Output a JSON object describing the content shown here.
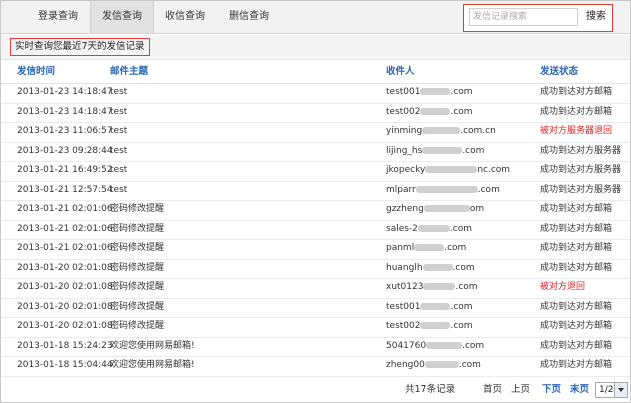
{
  "tabs": [
    {
      "label": "登录查询",
      "active": false
    },
    {
      "label": "发信查询",
      "active": true
    },
    {
      "label": "收信查询",
      "active": false
    },
    {
      "label": "删信查询",
      "active": false
    }
  ],
  "search": {
    "placeholder": "发信记录搜索",
    "button": "搜索"
  },
  "notice": "实时查询您最近7天的发信记录",
  "columns": {
    "time": "发信时间",
    "subject": "邮件主题",
    "recipient": "收件人",
    "status": "发送状态"
  },
  "rows": [
    {
      "time": "2013-01-23 14:18:47",
      "subject": "test",
      "rcpt_prefix": "test001",
      "rcpt_suffix": ".com",
      "status": "成功到达对方邮箱",
      "status_type": "ok"
    },
    {
      "time": "2013-01-23 14:18:47",
      "subject": "test",
      "rcpt_prefix": "test002",
      "rcpt_suffix": ".com",
      "status": "成功到达对方邮箱",
      "status_type": "ok"
    },
    {
      "time": "2013-01-23 11:06:57",
      "subject": "test",
      "rcpt_prefix": "yinming",
      "rcpt_suffix": ".com.cn",
      "status": "被对方服务器退回",
      "status_type": "error"
    },
    {
      "time": "2013-01-23 09:28:44",
      "subject": "test",
      "rcpt_prefix": "lijing_hs",
      "rcpt_suffix": ".com",
      "status": "成功到达对方服务器",
      "status_type": "ok"
    },
    {
      "time": "2013-01-21 16:49:52",
      "subject": "test",
      "rcpt_prefix": "jkopecky",
      "rcpt_suffix": "nc.com",
      "status": "成功到达对方服务器",
      "status_type": "ok"
    },
    {
      "time": "2013-01-21 12:57:54",
      "subject": "test",
      "rcpt_prefix": "mlparr",
      "rcpt_suffix": ".com",
      "status": "成功到达对方服务器",
      "status_type": "ok"
    },
    {
      "time": "2013-01-21 02:01:06",
      "subject": "密码修改提醒",
      "rcpt_prefix": "gzzheng",
      "rcpt_suffix": "om",
      "status": "成功到达对方邮箱",
      "status_type": "ok"
    },
    {
      "time": "2013-01-21 02:01:06",
      "subject": "密码修改提醒",
      "rcpt_prefix": "sales-2",
      "rcpt_suffix": ".com",
      "status": "成功到达对方邮箱",
      "status_type": "ok"
    },
    {
      "time": "2013-01-21 02:01:06",
      "subject": "密码修改提醒",
      "rcpt_prefix": "panml",
      "rcpt_suffix": ".com",
      "status": "成功到达对方邮箱",
      "status_type": "ok"
    },
    {
      "time": "2013-01-20 02:01:08",
      "subject": "密码修改提醒",
      "rcpt_prefix": "huanglh",
      "rcpt_suffix": ".com",
      "status": "成功到达对方邮箱",
      "status_type": "ok"
    },
    {
      "time": "2013-01-20 02:01:08",
      "subject": "密码修改提醒",
      "rcpt_prefix": "xut0123",
      "rcpt_suffix": ".com",
      "status": "被对方退回",
      "status_type": "error"
    },
    {
      "time": "2013-01-20 02:01:08",
      "subject": "密码修改提醒",
      "rcpt_prefix": "test001",
      "rcpt_suffix": ".com",
      "status": "成功到达对方邮箱",
      "status_type": "ok"
    },
    {
      "time": "2013-01-20 02:01:08",
      "subject": "密码修改提醒",
      "rcpt_prefix": "test002",
      "rcpt_suffix": ".com",
      "status": "成功到达对方邮箱",
      "status_type": "ok"
    },
    {
      "time": "2013-01-18 15:24:23",
      "subject": "欢迎您使用网易邮箱!",
      "rcpt_prefix": "5041760",
      "rcpt_suffix": ".com",
      "status": "成功到达对方邮箱",
      "status_type": "ok"
    },
    {
      "time": "2013-01-18 15:04:44",
      "subject": "欢迎您使用网易邮箱!",
      "rcpt_prefix": "zheng00",
      "rcpt_suffix": ".com",
      "status": "成功到达对方邮箱",
      "status_type": "ok"
    }
  ],
  "footer": {
    "total": "共17条记录",
    "first": "首页",
    "prev": "上页",
    "next": "下页",
    "last": "末页",
    "page": "1/2"
  },
  "colors": {
    "link_blue": "#2a66b5",
    "error_red": "#e02020",
    "highlight_red": "#e53b3b"
  }
}
